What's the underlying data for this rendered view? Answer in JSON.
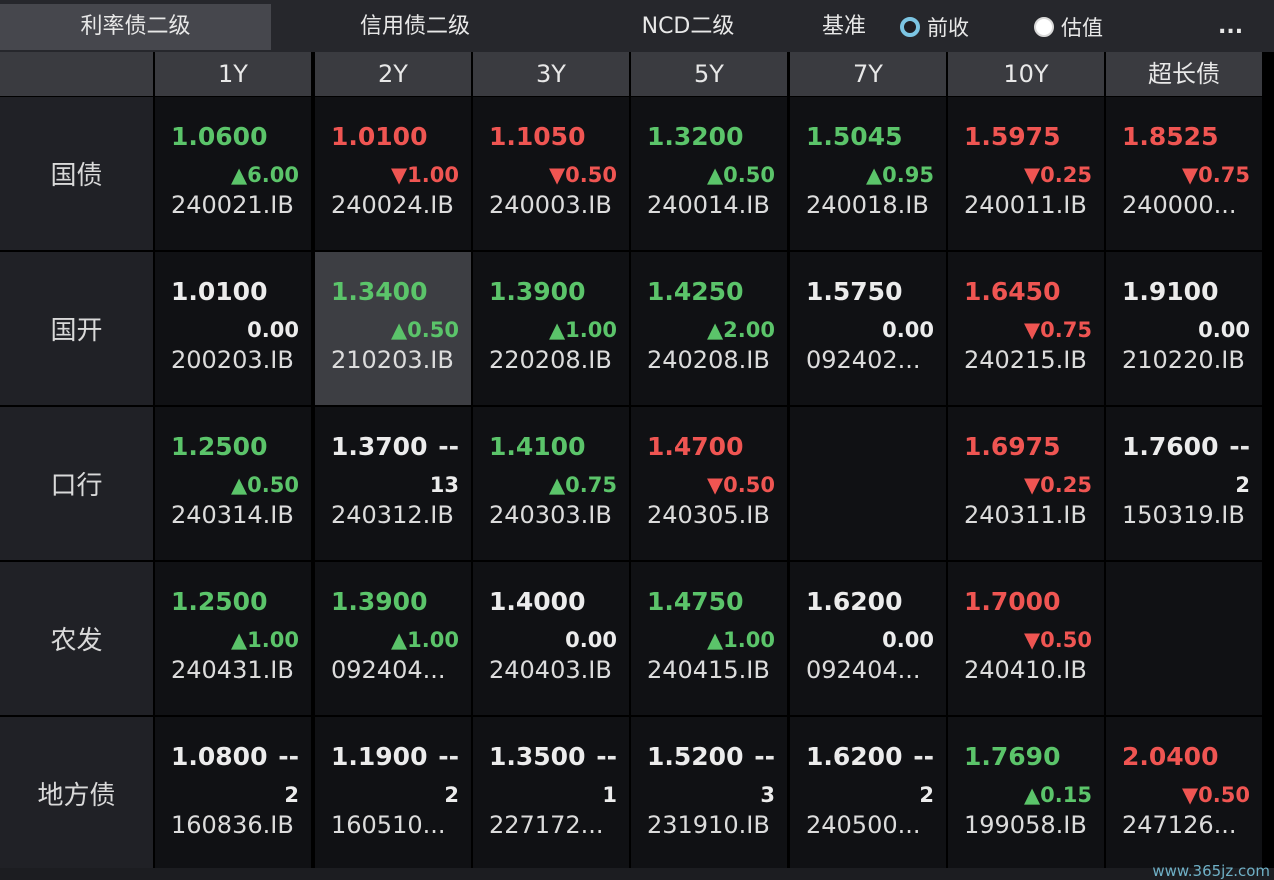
{
  "tabs": [
    "利率债二级",
    "信用债二级",
    "NCD二级"
  ],
  "benchmark": {
    "label": "基准",
    "options": [
      "前收",
      "估值"
    ],
    "selected": "前收"
  },
  "more_label": "...",
  "columns": [
    "1Y",
    "2Y",
    "3Y",
    "5Y",
    "7Y",
    "10Y",
    "超长债"
  ],
  "rows": [
    "国债",
    "国开",
    "口行",
    "农发",
    "地方债"
  ],
  "colors": {
    "up": "#5bc46a",
    "down": "#ef5552",
    "flat": "#ececec"
  },
  "cells": [
    [
      {
        "yield": "1.0600",
        "change": "▲6.00",
        "code": "240021.IB",
        "dir": "up"
      },
      {
        "yield": "1.0100",
        "change": "▼1.00",
        "code": "240024.IB",
        "dir": "down"
      },
      {
        "yield": "1.1050",
        "change": "▼0.50",
        "code": "240003.IB",
        "dir": "down"
      },
      {
        "yield": "1.3200",
        "change": "▲0.50",
        "code": "240014.IB",
        "dir": "up"
      },
      {
        "yield": "1.5045",
        "change": "▲0.95",
        "code": "240018.IB",
        "dir": "up"
      },
      {
        "yield": "1.5975",
        "change": "▼0.25",
        "code": "240011.IB",
        "dir": "down"
      },
      {
        "yield": "1.8525",
        "change": "▼0.75",
        "code": "240000...",
        "dir": "down"
      }
    ],
    [
      {
        "yield": "1.0100",
        "change": "0.00",
        "code": "200203.IB",
        "dir": "flat"
      },
      {
        "yield": "1.3400",
        "change": "▲0.50",
        "code": "210203.IB",
        "dir": "up"
      },
      {
        "yield": "1.3900",
        "change": "▲1.00",
        "code": "220208.IB",
        "dir": "up"
      },
      {
        "yield": "1.4250",
        "change": "▲2.00",
        "code": "240208.IB",
        "dir": "up"
      },
      {
        "yield": "1.5750",
        "change": "0.00",
        "code": "092402...",
        "dir": "flat"
      },
      {
        "yield": "1.6450",
        "change": "▼0.75",
        "code": "240215.IB",
        "dir": "down"
      },
      {
        "yield": "1.9100",
        "change": "0.00",
        "code": "210220.IB",
        "dir": "flat"
      }
    ],
    [
      {
        "yield": "1.2500",
        "change": "▲0.50",
        "code": "240314.IB",
        "dir": "up"
      },
      {
        "yield": "1.3700",
        "dash": "--",
        "change": "13",
        "code": "240312.IB",
        "dir": "flat"
      },
      {
        "yield": "1.4100",
        "change": "▲0.75",
        "code": "240303.IB",
        "dir": "up"
      },
      {
        "yield": "1.4700",
        "change": "▼0.50",
        "code": "240305.IB",
        "dir": "down"
      },
      null,
      {
        "yield": "1.6975",
        "change": "▼0.25",
        "code": "240311.IB",
        "dir": "down"
      },
      {
        "yield": "1.7600",
        "dash": "--",
        "change": "2",
        "code": "150319.IB",
        "dir": "flat"
      }
    ],
    [
      {
        "yield": "1.2500",
        "change": "▲1.00",
        "code": "240431.IB",
        "dir": "up"
      },
      {
        "yield": "1.3900",
        "change": "▲1.00",
        "code": "092404...",
        "dir": "up"
      },
      {
        "yield": "1.4000",
        "change": "0.00",
        "code": "240403.IB",
        "dir": "flat"
      },
      {
        "yield": "1.4750",
        "change": "▲1.00",
        "code": "240415.IB",
        "dir": "up"
      },
      {
        "yield": "1.6200",
        "change": "0.00",
        "code": "092404...",
        "dir": "flat"
      },
      {
        "yield": "1.7000",
        "change": "▼0.50",
        "code": "240410.IB",
        "dir": "down"
      },
      null
    ],
    [
      {
        "yield": "1.0800",
        "dash": "--",
        "change": "2",
        "code": "160836.IB",
        "dir": "flat"
      },
      {
        "yield": "1.1900",
        "dash": "--",
        "change": "2",
        "code": "160510...",
        "dir": "flat"
      },
      {
        "yield": "1.3500",
        "dash": "--",
        "change": "1",
        "code": "227172...",
        "dir": "flat"
      },
      {
        "yield": "1.5200",
        "dash": "--",
        "change": "3",
        "code": "231910.IB",
        "dir": "flat"
      },
      {
        "yield": "1.6200",
        "dash": "--",
        "change": "2",
        "code": "240500...",
        "dir": "flat"
      },
      {
        "yield": "1.7690",
        "change": "▲0.15",
        "code": "199058.IB",
        "dir": "up"
      },
      {
        "yield": "2.0400",
        "change": "▼0.50",
        "code": "247126...",
        "dir": "down"
      }
    ]
  ],
  "watermark": "www.365jz.com"
}
